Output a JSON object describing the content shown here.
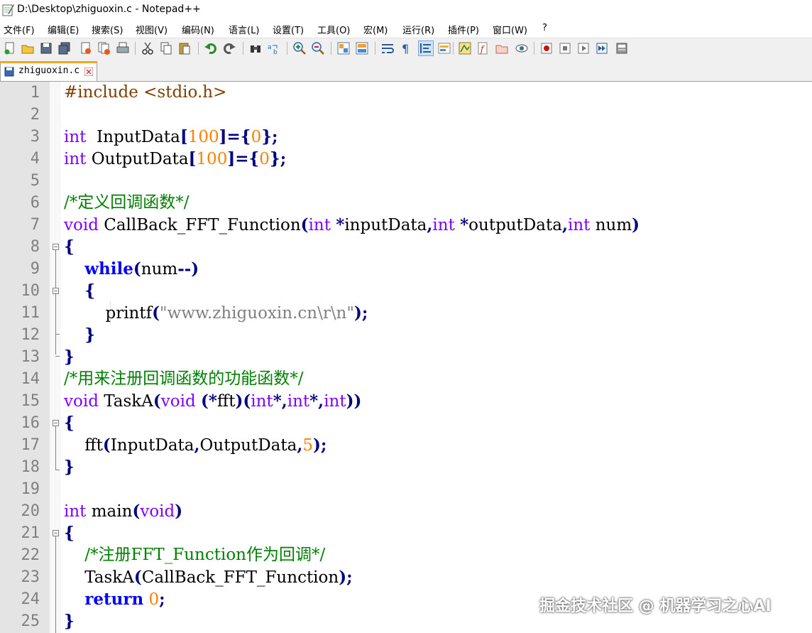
{
  "window": {
    "title": "D:\\Desktop\\zhiguoxin.c - Notepad++",
    "app_icon": "notepad-icon"
  },
  "menu": [
    "文件(F)",
    "编辑(E)",
    "搜索(S)",
    "视图(V)",
    "编码(N)",
    "语言(L)",
    "设置(T)",
    "工具(O)",
    "宏(M)",
    "运行(R)",
    "插件(P)",
    "窗口(W)",
    "?"
  ],
  "toolbar": [
    "new-file-icon",
    "open-file-icon",
    "save-icon",
    "save-all-icon",
    "close-icon",
    "close-all-icon",
    "print-icon",
    "cut-icon",
    "copy-icon",
    "paste-icon",
    "undo-icon",
    "redo-icon",
    "find-icon",
    "replace-icon",
    "zoom-in-icon",
    "zoom-out-icon",
    "sync-vertical-icon",
    "sync-horizontal-icon",
    "word-wrap-icon",
    "show-all-chars-icon",
    "indent-guide-icon",
    "udl-icon",
    "doc-map-icon",
    "function-list-icon",
    "folder-workspace-icon",
    "monitoring-icon",
    "record-macro-icon",
    "stop-record-icon",
    "play-macro-icon",
    "run-macro-multiple-icon",
    "save-macro-icon"
  ],
  "tab": {
    "label": "zhiguoxin.c",
    "icon": "save-state-icon",
    "close_icon": "close-tab-icon"
  },
  "editor": {
    "line_numbers": [
      "1",
      "2",
      "3",
      "4",
      "5",
      "6",
      "7",
      "8",
      "9",
      "10",
      "11",
      "12",
      "13",
      "14",
      "15",
      "16",
      "17",
      "18",
      "19",
      "20",
      "21",
      "22",
      "23",
      "24",
      "25"
    ]
  },
  "watermark": "掘金技术社区 @ 机器学习之心AI"
}
